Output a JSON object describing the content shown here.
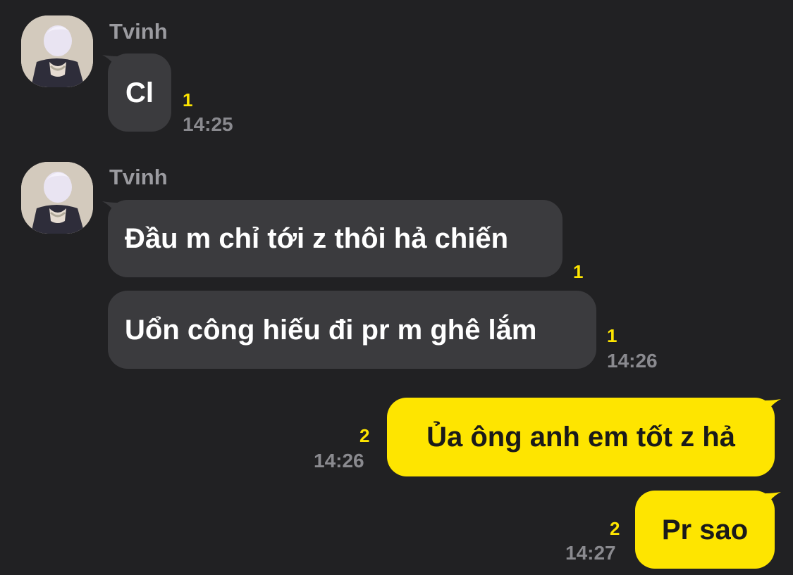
{
  "messages_block_1": {
    "sender": "Tvinh",
    "bubble_1": {
      "text": "Cl",
      "unread": "1",
      "time": "14:25"
    }
  },
  "messages_block_2": {
    "sender": "Tvinh",
    "bubble_1": {
      "text": "Đầu m chỉ tới z thôi hả chiến",
      "unread": "1"
    },
    "bubble_2": {
      "text": "Uổn công hiếu đi pr m ghê lắm",
      "unread": "1",
      "time": "14:26"
    }
  },
  "outgoing": {
    "bubble_1": {
      "text": "Ủa ông anh em tốt z hả",
      "unread": "2",
      "time": "14:26"
    },
    "bubble_2": {
      "text": "Pr sao",
      "unread": "2",
      "time": "14:27"
    }
  },
  "colors": {
    "background": "#212123",
    "incoming_bubble": "#3b3b3e",
    "outgoing_bubble": "#fee500",
    "unread_count": "#fee500"
  }
}
